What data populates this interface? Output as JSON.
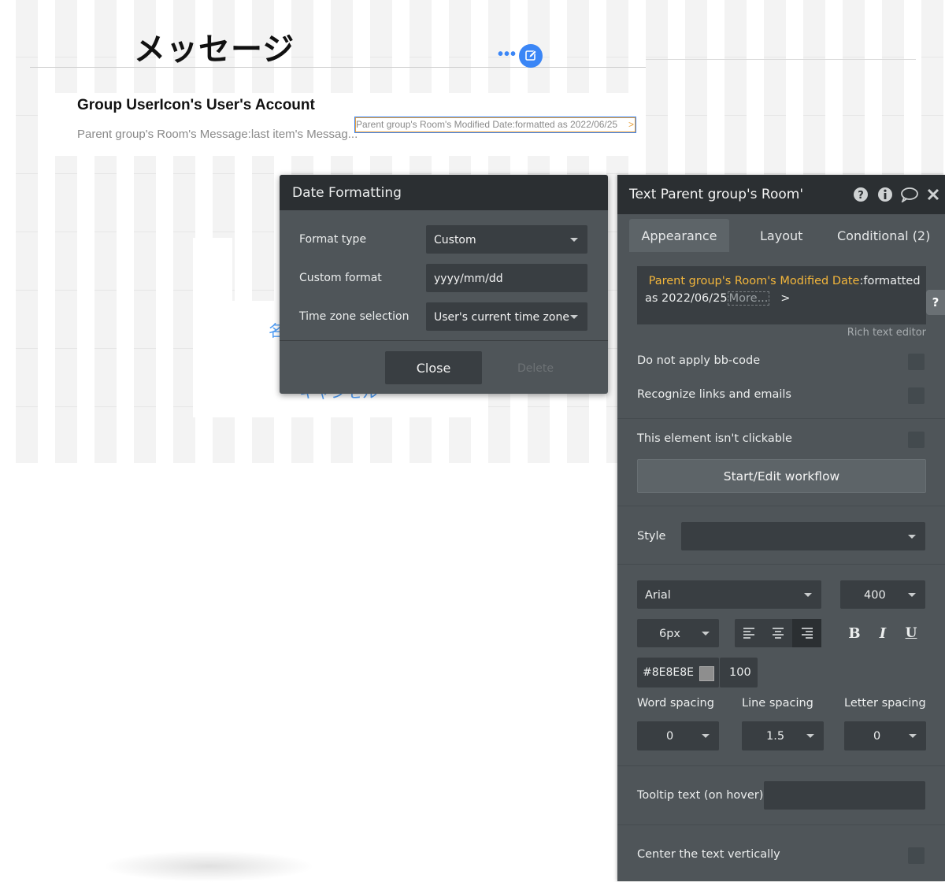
{
  "canvas": {
    "page_title": "メッセージ",
    "card_title": "Group UserIcon's User's Account",
    "card_message": "Parent group's Room's Message:last item's Messag...",
    "selected_text": "Parent group's Room's Modified Date:formatted as 2022/06/25",
    "selected_arrow": ">",
    "ghost_text_1": "名",
    "ghost_text_2": "キャンセル"
  },
  "date_dialog": {
    "title": "Date Formatting",
    "rows": [
      {
        "label": "Format type",
        "value": "Custom",
        "dropdown": true
      },
      {
        "label": "Custom format",
        "value": "yyyy/mm/dd",
        "dropdown": false
      },
      {
        "label": "Time zone selection",
        "value": "User's current time zone",
        "dropdown": true
      }
    ],
    "close_label": "Close",
    "delete_label": "Delete"
  },
  "panel": {
    "title": "Text Parent group's Room'",
    "tabs": [
      "Appearance",
      "Layout",
      "Conditional (2)"
    ],
    "rte": {
      "dynamic": "Parent group's Room's Modified Date",
      "static": ":formatted as 2022/06/25",
      "more": "More...",
      "arrow": ">"
    },
    "help_label": "?",
    "rte_caption": "Rich text editor",
    "checks": {
      "bbcode": "Do not apply bb-code",
      "links": "Recognize links and emails",
      "clickable": "This element isn't clickable"
    },
    "workflow_button": "Start/Edit workflow",
    "style_label": "Style",
    "style_value": "",
    "font_family": "Arial",
    "font_weight": "400",
    "font_size": "6px",
    "align_options": [
      "left",
      "center",
      "right"
    ],
    "align_selected": "right",
    "bold": "B",
    "italic": "I",
    "underline": "U",
    "color_hex": "#8E8E8E",
    "opacity": "100",
    "spacing": {
      "word_label": "Word spacing",
      "word_value": "0",
      "line_label": "Line spacing",
      "line_value": "1.5",
      "letter_label": "Letter spacing",
      "letter_value": "0"
    },
    "tooltip_label": "Tooltip text (on hover)",
    "center_label": "Center the text vertically"
  },
  "colors": {
    "accent": "#3b86f6",
    "dynamic_text": "#f3b63b",
    "panel_bg": "#4f5559",
    "panel_dark": "#2b2f32"
  }
}
